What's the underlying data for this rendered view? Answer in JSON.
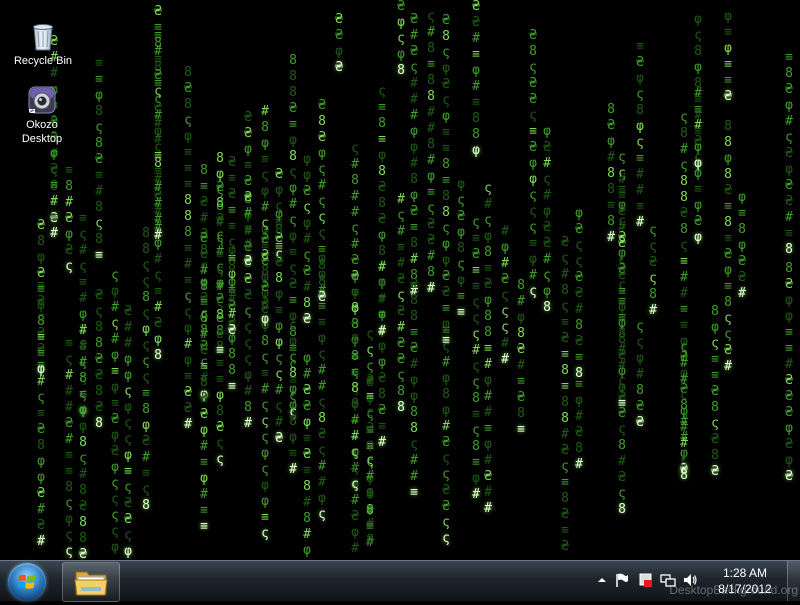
{
  "desktop": {
    "background_color": "#000000",
    "rain_colors": {
      "dim": "#1f5a14",
      "mid": "#3f9e2a",
      "bright": "#7fdc55",
      "head": "#e6ffd6"
    },
    "rain_glyphs": [
      "ς",
      "φ",
      "8",
      "#",
      "≡",
      "₴"
    ],
    "icons": [
      {
        "label": "Recycle Bin",
        "icon": "recycle-bin-icon"
      },
      {
        "label": "Okozo\nDesktop",
        "icon": "okozo-desktop-icon"
      }
    ]
  },
  "taskbar": {
    "start_button": "windows-start-orb",
    "pinned": [
      {
        "icon": "windows-explorer-icon"
      }
    ],
    "tray_icons": [
      "show-hidden-icons-arrow",
      "action-center-flag-icon",
      "network-icon",
      "volume-icon"
    ],
    "clock": {
      "time": "1:28 AM",
      "date": "8/17/2012"
    },
    "watermark": "DesktopBackground.org"
  }
}
